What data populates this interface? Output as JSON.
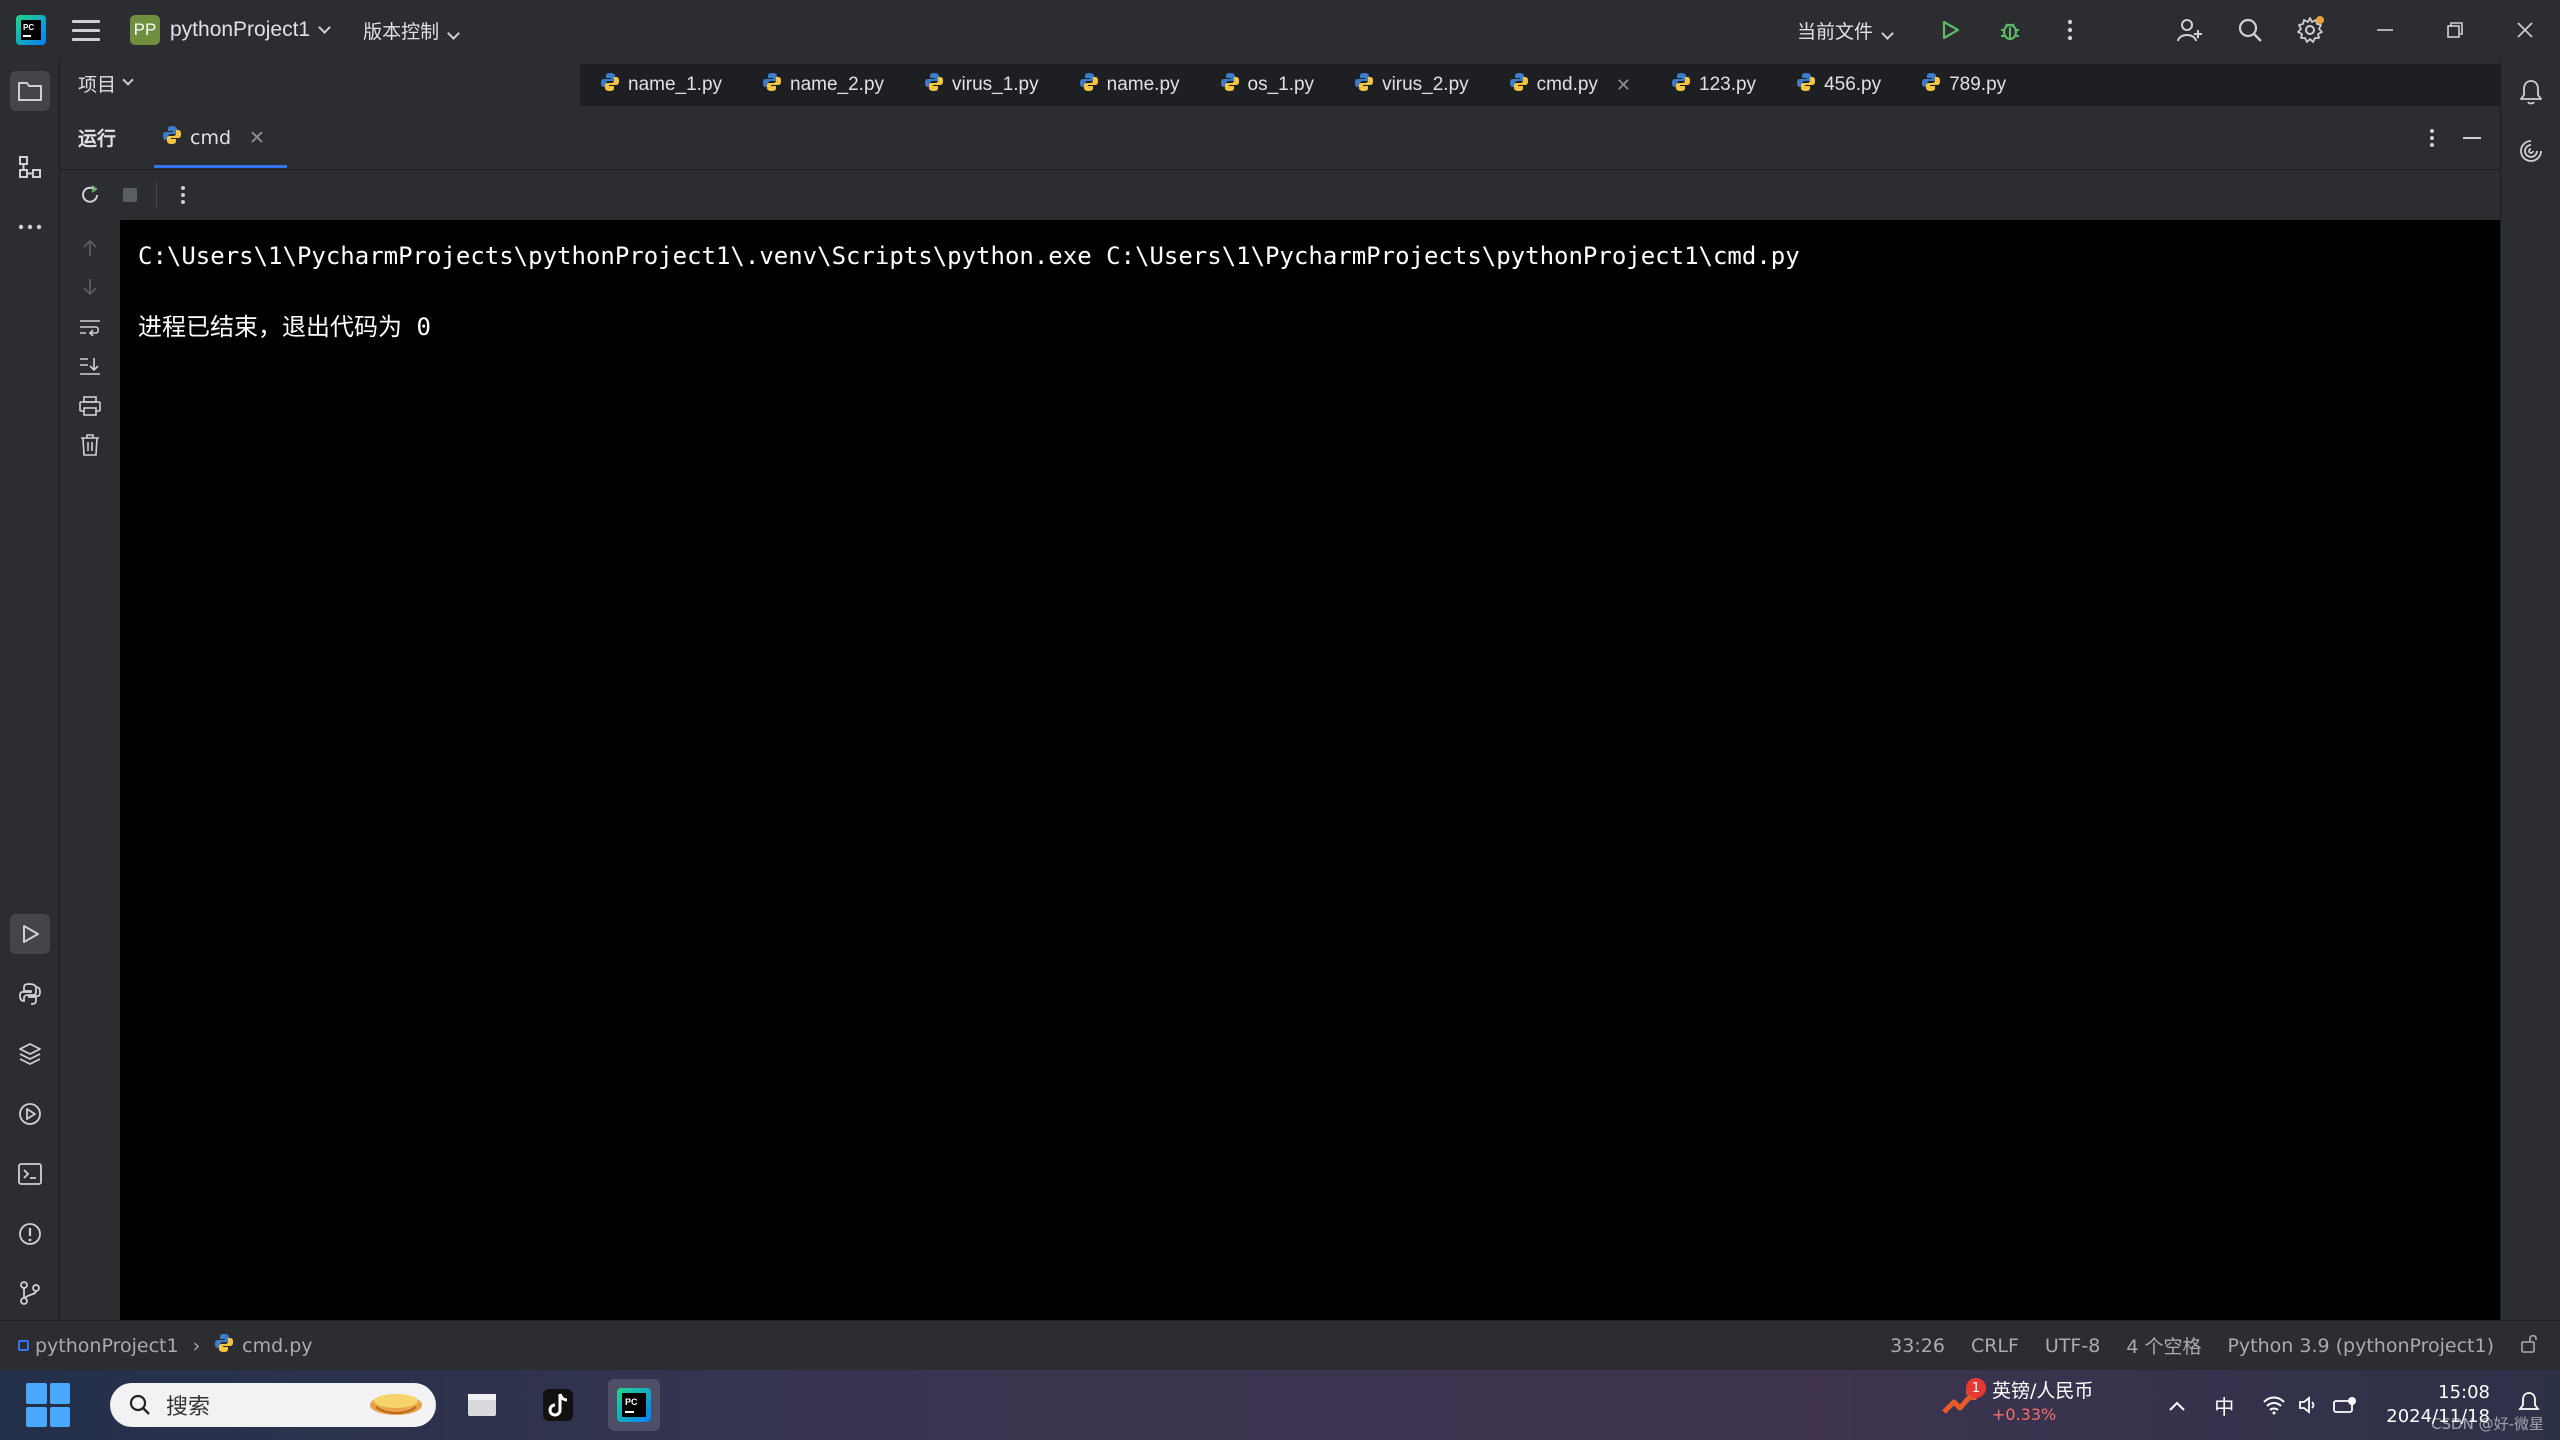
{
  "titlebar": {
    "project_badge": "PP",
    "project_name": "pythonProject1",
    "vcs_label": "版本控制",
    "current_file_label": "当前文件"
  },
  "left_panel": {
    "project_label": "项目"
  },
  "editor_tabs": [
    {
      "label": "name_1.py"
    },
    {
      "label": "name_2.py"
    },
    {
      "label": "virus_1.py"
    },
    {
      "label": "name.py"
    },
    {
      "label": "os_1.py"
    },
    {
      "label": "virus_2.py"
    },
    {
      "label": "cmd.py",
      "active": true
    },
    {
      "label": "123.py"
    },
    {
      "label": "456.py"
    },
    {
      "label": "789.py"
    }
  ],
  "run_panel": {
    "title": "运行",
    "tab_label": "cmd"
  },
  "console": {
    "command_line": "C:\\Users\\1\\PycharmProjects\\pythonProject1\\.venv\\Scripts\\python.exe C:\\Users\\1\\PycharmProjects\\pythonProject1\\cmd.py",
    "exit_message_prefix": "进程已结束，退出代码为 ",
    "exit_code": "0"
  },
  "statusbar": {
    "breadcrumb_project": "pythonProject1",
    "breadcrumb_file": "cmd.py",
    "cursor_position": "33:26",
    "line_separator": "CRLF",
    "encoding": "UTF-8",
    "indent": "4 个空格",
    "interpreter": "Python 3.9 (pythonProject1)"
  },
  "taskbar": {
    "search_placeholder": "搜索",
    "news_title": "英镑/人民币",
    "news_change": "+0.33%",
    "news_badge": "1",
    "ime_label": "中",
    "time": "15:08",
    "date": "2024/11/18",
    "watermark": "CSDN @好-微星"
  },
  "colors": {
    "accent": "#3574f0",
    "run_green": "#5fb865",
    "python_blue": "#3d7cc9",
    "python_yellow": "#f4c542",
    "console_bg": "#000000"
  }
}
